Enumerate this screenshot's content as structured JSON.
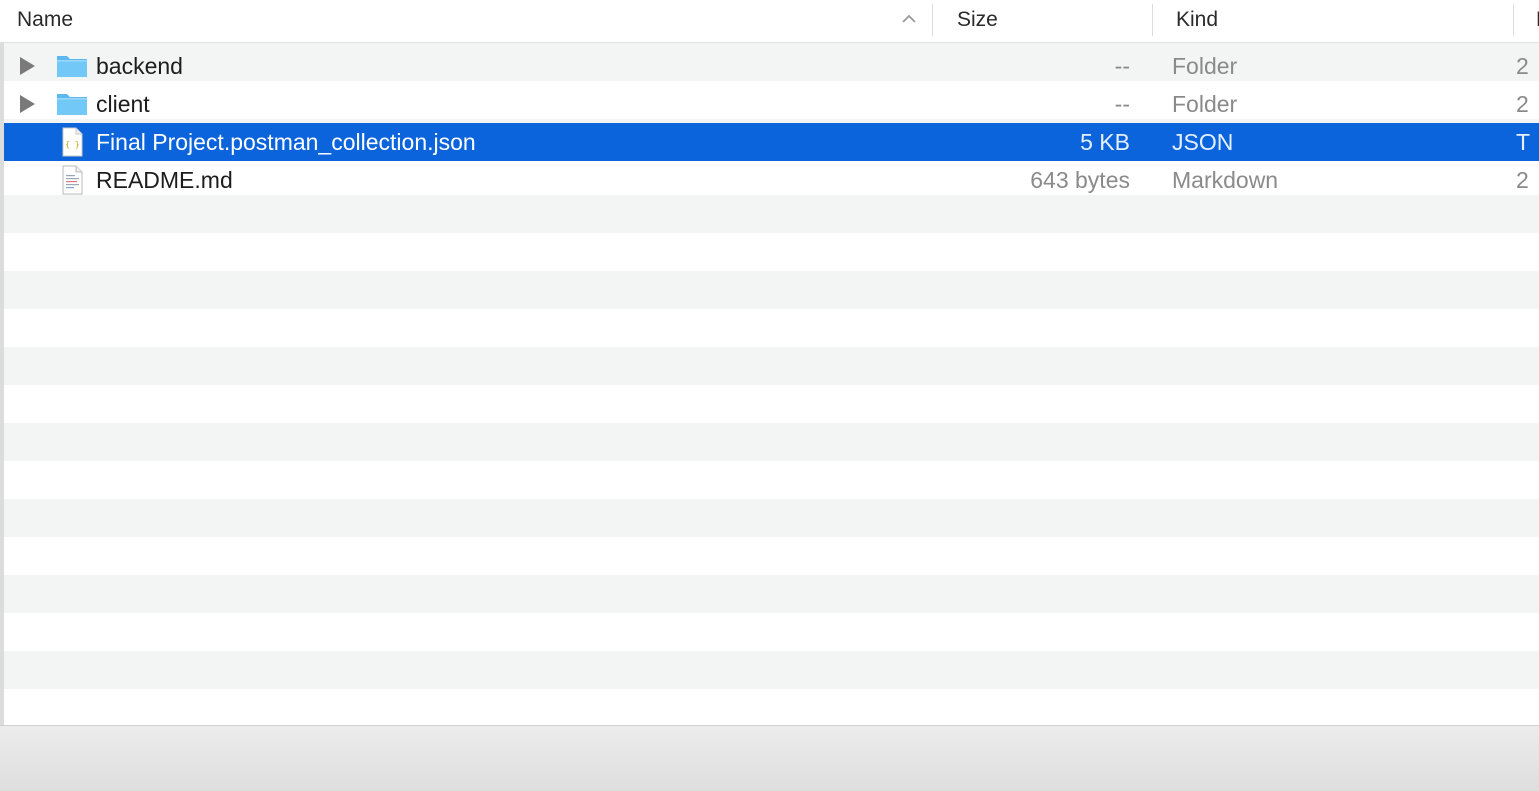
{
  "columns": {
    "name": "Name",
    "size": "Size",
    "kind": "Kind",
    "date_partial": "D"
  },
  "sort": {
    "column": "name",
    "direction": "ascending",
    "icon": "chevron-up-icon"
  },
  "files": [
    {
      "name": "backend",
      "size": "--",
      "kind": "Folder",
      "date_partial": "2",
      "icon": "folder-icon",
      "expandable": true,
      "selected": false
    },
    {
      "name": "client",
      "size": "--",
      "kind": "Folder",
      "date_partial": "2",
      "icon": "folder-icon",
      "expandable": true,
      "selected": false
    },
    {
      "name": "Final Project.postman_collection.json",
      "size": "5 KB",
      "kind": "JSON",
      "date_partial": "T",
      "icon": "json-file-icon",
      "expandable": false,
      "selected": true
    },
    {
      "name": "README.md",
      "size": "643 bytes",
      "kind": "Markdown",
      "date_partial": "2",
      "icon": "text-file-icon",
      "expandable": false,
      "selected": false
    }
  ],
  "colors": {
    "selection": "#0b64dc",
    "folder": "#6cc6f7",
    "stripe": "#f3f4f4",
    "secondary_text": "#8a8a8a"
  }
}
